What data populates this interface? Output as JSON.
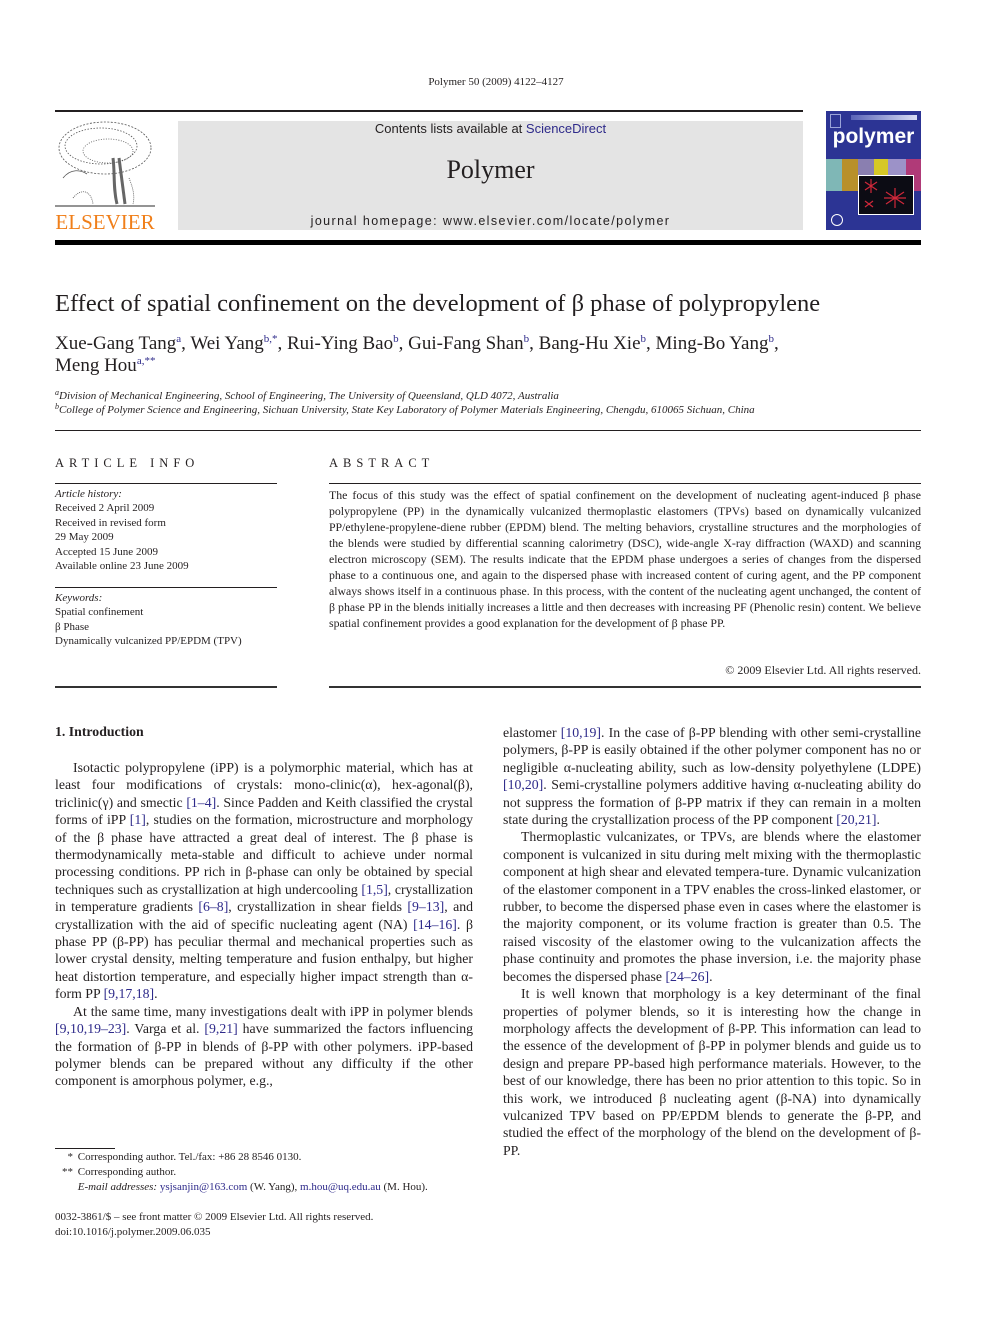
{
  "header": {
    "citation": "Polymer 50 (2009) 4122–4127",
    "contents_prefix": "Contents lists available at ",
    "contents_link": "ScienceDirect",
    "journal_name": "Polymer",
    "homepage": "journal homepage: www.elsevier.com/locate/polymer",
    "publisher_logo_text": "ELSEVIER",
    "cover_title": "polymer",
    "colors": {
      "publisher_orange": "#f07f1a",
      "link_blue": "#2e2a8a",
      "cover_blue": "#2c3494",
      "banner_gray": "#e4e4e4"
    }
  },
  "article": {
    "title": "Effect of spatial confinement on the development of β phase of polypropylene",
    "authors": [
      {
        "name": "Xue-Gang Tang",
        "sup": "a",
        "sep": ", "
      },
      {
        "name": "Wei Yang",
        "sup": "b,*",
        "sep": ", "
      },
      {
        "name": "Rui-Ying Bao",
        "sup": "b",
        "sep": ", "
      },
      {
        "name": "Gui-Fang Shan",
        "sup": "b",
        "sep": ", "
      },
      {
        "name": "Bang-Hu Xie",
        "sup": "b",
        "sep": ", "
      },
      {
        "name": "Ming-Bo Yang",
        "sup": "b",
        "sep": ","
      },
      {
        "name": "Meng Hou",
        "sup": "a,**",
        "sep": ""
      }
    ],
    "affiliations": [
      {
        "mark": "a",
        "text": "Division of Mechanical Engineering, School of Engineering, The University of Queensland, QLD 4072, Australia"
      },
      {
        "mark": "b",
        "text": "College of Polymer Science and Engineering, Sichuan University, State Key Laboratory of Polymer Materials Engineering, Chengdu, 610065 Sichuan, China"
      }
    ]
  },
  "article_info": {
    "heading": "ARTICLE INFO",
    "history_label": "Article history:",
    "history": [
      "Received 2 April 2009",
      "Received in revised form",
      "29 May 2009",
      "Accepted 15 June 2009",
      "Available online 23 June 2009"
    ],
    "keywords_label": "Keywords:",
    "keywords": [
      "Spatial confinement",
      "β Phase",
      "Dynamically vulcanized PP/EPDM (TPV)"
    ]
  },
  "abstract": {
    "heading": "ABSTRACT",
    "text": "The focus of this study was the effect of spatial confinement on the development of nucleating agent-induced β phase polypropylene (PP) in the dynamically vulcanized thermoplastic elastomers (TPVs) based on dynamically vulcanized PP/ethylene-propylene-diene rubber (EPDM) blend. The melting behaviors, crystalline structures and the morphologies of the blends were studied by differential scanning calorimetry (DSC), wide-angle X-ray diffraction (WAXD) and scanning electron microscopy (SEM). The results indicate that the EPDM phase undergoes a series of changes from the dispersed phase to a continuous one, and again to the dispersed phase with increased content of curing agent, and the PP component always shows itself in a continuous phase. In this process, with the content of the nucleating agent unchanged, the content of β phase PP in the blends initially increases a little and then decreases with increasing PF (Phenolic resin) content. We believe spatial confinement provides a good explanation for the development of β phase PP.",
    "copyright": "© 2009 Elsevier Ltd. All rights reserved."
  },
  "body": {
    "section_heading": "1.  Introduction",
    "left_paragraphs": [
      [
        {
          "t": "Isotactic polypropylene (iPP) is a polymorphic material, which has at least four modifications of crystals: mono-clinic(α), hex-agonal(β), triclinic(γ) and smectic "
        },
        {
          "c": "[1–4]"
        },
        {
          "t": ". Since Padden and Keith classified the crystal forms of iPP "
        },
        {
          "c": "[1]"
        },
        {
          "t": ", studies on the formation, microstructure and morphology of the β phase have attracted a great deal of interest. The β phase is thermodynamically meta-stable and difficult to achieve under normal processing conditions. PP rich in β-phase can only be obtained by special techniques such as crystallization at high undercooling "
        },
        {
          "c": "[1,5]"
        },
        {
          "t": ", crystallization in temperature gradients "
        },
        {
          "c": "[6–8]"
        },
        {
          "t": ", crystallization in shear fields "
        },
        {
          "c": "[9–13]"
        },
        {
          "t": ", and crystallization with the aid of specific nucleating agent (NA) "
        },
        {
          "c": "[14–16]"
        },
        {
          "t": ". β phase PP (β-PP) has peculiar thermal and mechanical properties such as lower crystal density, melting temperature and fusion enthalpy, but higher heat distortion temperature, and especially higher impact strength than α-form PP "
        },
        {
          "c": "[9,17,18]"
        },
        {
          "t": "."
        }
      ],
      [
        {
          "t": "At the same time, many investigations dealt with iPP in polymer blends "
        },
        {
          "c": "[9,10,19–23]"
        },
        {
          "t": ". Varga et al. "
        },
        {
          "c": "[9,21]"
        },
        {
          "t": " have summarized the factors influencing the formation of β-PP in blends of β-PP with other polymers. iPP-based polymer blends can be prepared without any difficulty if the other component is amorphous polymer, e.g.,"
        }
      ]
    ],
    "right_paragraphs": [
      [
        {
          "t": "elastomer "
        },
        {
          "c": "[10,19]"
        },
        {
          "t": ". In the case of β-PP blending with other semi-crystalline polymers, β-PP is easily obtained if the other polymer component has no or negligible α-nucleating ability, such as low-density polyethylene (LDPE) "
        },
        {
          "c": "[10,20]"
        },
        {
          "t": ". Semi-crystalline polymers additive having α-nucleating ability do not suppress the formation of β-PP matrix if they can remain in a molten state during the crystallization process of the PP component "
        },
        {
          "c": "[20,21]"
        },
        {
          "t": "."
        }
      ],
      [
        {
          "t": "Thermoplastic vulcanizates, or TPVs, are blends where the elastomer component is vulcanized in situ during melt mixing with the thermoplastic component at high shear and elevated tempera-ture. Dynamic vulcanization of the elastomer component in a TPV enables the cross-linked elastomer, or rubber, to become the dispersed phase even in cases where the elastomer is the majority component, or its volume fraction is greater than 0.5. The raised viscosity of the elastomer owing to the vulcanization affects the phase continuity and promotes the phase inversion, i.e. the majority phase becomes the dispersed phase "
        },
        {
          "c": "[24–26]"
        },
        {
          "t": "."
        }
      ],
      [
        {
          "t": "It is well known that morphology is a key determinant of the final properties of polymer blends, so it is interesting how the change in morphology affects the development of β-PP. This information can lead to the essence of the development of β-PP in polymer blends and guide us to design and prepare PP-based high performance materials. However, to the best of our knowledge, there has been no prior attention to this topic. So in this work, we introduced β nucleating agent (β-NA) into dynamically vulcanized TPV based on PP/EPDM blends to generate the β-PP, and studied the effect of the morphology of the blend on the development of β-PP."
        }
      ]
    ]
  },
  "footnotes": {
    "fn1_mark": "*",
    "fn1_text": "Corresponding author. Tel./fax: +86 28 8546 0130.",
    "fn2_mark": "**",
    "fn2_text": "Corresponding author.",
    "email_label": "E-mail addresses: ",
    "email1": "ysjsanjin@163.com",
    "email1_owner": " (W. Yang), ",
    "email2": "m.hou@uq.edu.au",
    "email2_owner": " (M. Hou).",
    "issn": "0032-3861/$ – see front matter © 2009 Elsevier Ltd. All rights reserved.",
    "doi": "doi:10.1016/j.polymer.2009.06.035"
  }
}
